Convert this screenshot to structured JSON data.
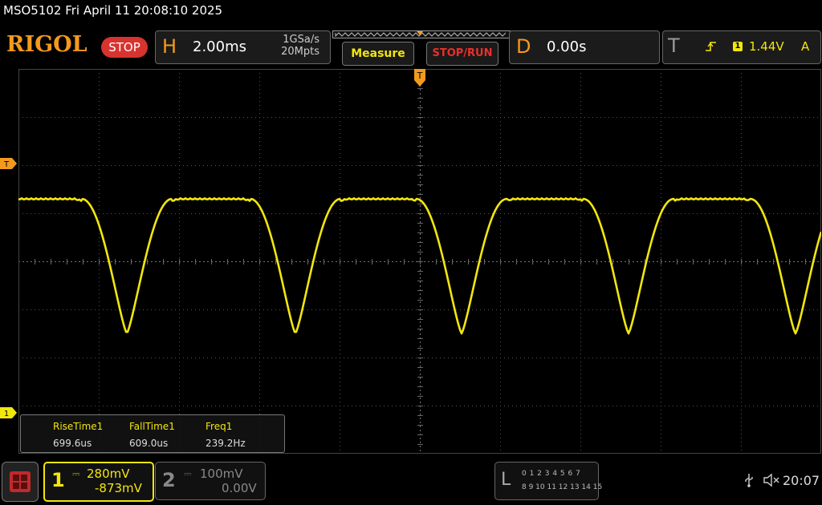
{
  "status_bar": {
    "title": "MSO5102  Fri April 11 20:08:10 2025"
  },
  "header": {
    "logo": "RIGOL",
    "run_state": "STOP",
    "horizontal": {
      "letter": "H",
      "timebase": "2.00ms",
      "sample_rate": "1GSa/s",
      "memory_depth": "20Mpts"
    },
    "measure_label": "Measure",
    "stoprun_label": "STOP/RUN",
    "delay": {
      "letter": "D",
      "value": "0.00s"
    },
    "trigger": {
      "letter": "T",
      "edge_icon": "rising-edge-icon",
      "channel": "1",
      "level": "1.44V",
      "mode": "A"
    }
  },
  "markers": {
    "trigger_top": "T",
    "trigger_level": "T",
    "ch1": "1"
  },
  "measurements": [
    {
      "label": "RiseTime1",
      "value": "699.6us"
    },
    {
      "label": "FallTime1",
      "value": "609.0us"
    },
    {
      "label": "Freq1",
      "value": "239.2Hz"
    }
  ],
  "bottom_bar": {
    "menu_icon": "grid-menu-icon",
    "ch1": {
      "number": "1",
      "coupling": "⎓",
      "scale": "280mV",
      "offset": "-873mV"
    },
    "ch2": {
      "number": "2",
      "coupling": "⎓",
      "scale": "100mV",
      "offset": "0.00V"
    },
    "logic": {
      "letter": "L",
      "row1": "0 1 2 3   4 5 6 7",
      "row2": "8 9 10 11 12 13 14 15"
    },
    "usb_icon": "usb-icon",
    "speaker_icon": "speaker-muted-icon",
    "clock": "20:07"
  },
  "colors": {
    "ch1": "#f2e60e",
    "accent": "#f39a1e",
    "stop": "#d7332f"
  },
  "chart_data": {
    "type": "line",
    "series": [
      {
        "name": "1",
        "color": "#f2e60e"
      }
    ],
    "grid": "10x8 dotted",
    "waveform": {
      "period_ms": 4.18,
      "high_level_div": 1.3,
      "low_level_div": -1.5,
      "dip_positions_div": [
        1.35,
        3.45,
        5.52,
        7.6,
        9.68
      ]
    }
  }
}
